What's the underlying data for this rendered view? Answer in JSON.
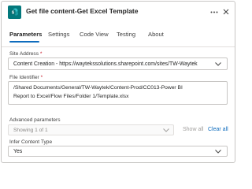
{
  "header": {
    "title": "Get file content-Get Excel Template",
    "icon": "sharepoint-icon",
    "accent": "#03787c"
  },
  "tabs": [
    {
      "label": "Parameters",
      "active": true
    },
    {
      "label": "Settings",
      "active": false
    },
    {
      "label": "Code View",
      "active": false
    },
    {
      "label": "Testing",
      "active": false
    },
    {
      "label": "About",
      "active": false
    }
  ],
  "site_address": {
    "label": "Site Address",
    "required_marker": "*",
    "value": "Content Creation - https://waytekssolutions.sharepoint.com/sites/TW-Waytek"
  },
  "file_identifier": {
    "label": "File Identifier",
    "required_marker": "*",
    "value_lines": [
      "/Shared Documents/General/TW-Waytek/Content-Prod/CC013-Power BI",
      "Report to Excel/Flow Files/Folder 1/Template.xlsx"
    ]
  },
  "advanced": {
    "label": "Advanced parameters",
    "select_value": "Showing 1 of 1",
    "show_all": "Show all",
    "clear_all": "Clear all"
  },
  "infer_content_type": {
    "label": "Infer Content Type",
    "value": "Yes"
  }
}
